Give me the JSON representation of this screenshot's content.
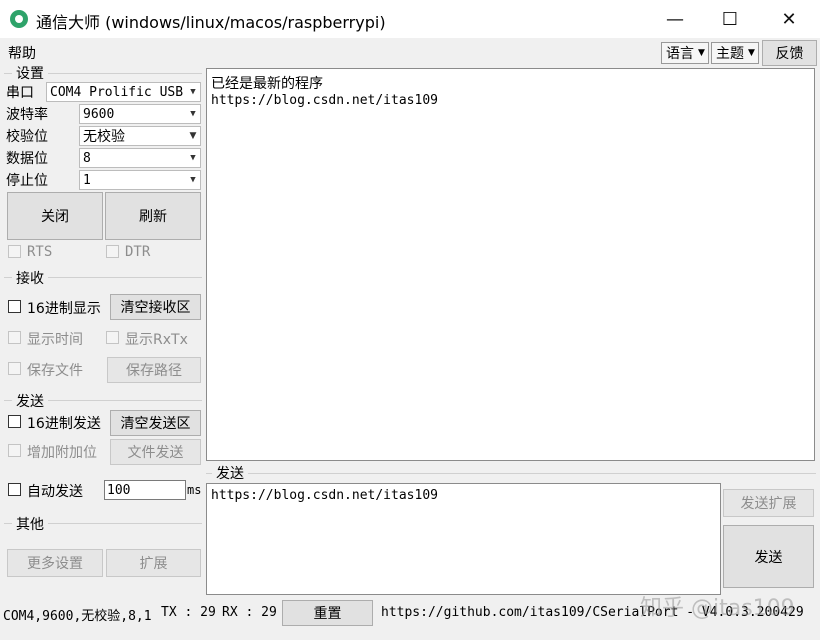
{
  "window": {
    "title": "通信大师 (windows/linux/macos/raspberrypi)",
    "minimize_glyph": "—",
    "maximize_glyph": "☐",
    "close_glyph": "✕"
  },
  "menu": {
    "help": "帮助"
  },
  "topbar": {
    "language_label": "语言",
    "theme_label": "主题",
    "feedback_label": "反馈",
    "dropdown_arrow": "▼"
  },
  "settings": {
    "group_title": "设置",
    "port_label": "串口",
    "port_value": "COM4 Prolific USB",
    "baud_label": "波特率",
    "baud_value": "9600",
    "parity_label": "校验位",
    "parity_value": "无校验",
    "databits_label": "数据位",
    "databits_value": "8",
    "stopbits_label": "停止位",
    "stopbits_value": "1",
    "close_button": "关闭",
    "refresh_button": "刷新",
    "rts_label": "RTS",
    "dtr_label": "DTR"
  },
  "receive": {
    "group_title": "接收",
    "hex_display_label": "16进制显示",
    "clear_button": "清空接收区",
    "show_time_label": "显示时间",
    "show_rxtx_label": "显示RxTx",
    "save_file_label": "保存文件",
    "save_path_button": "保存路径",
    "content_line1": "已经是最新的程序",
    "content_line2": "https://blog.csdn.net/itas109"
  },
  "send": {
    "group_title": "发送",
    "hex_send_label": "16进制发送",
    "clear_button": "清空发送区",
    "append_bit_label": "增加附加位",
    "file_send_button": "文件发送",
    "auto_send_label": "自动发送",
    "interval_value": "100",
    "interval_unit": "ms",
    "area_title": "发送",
    "content": "https://blog.csdn.net/itas109",
    "expand_button": "发送扩展",
    "send_button": "发送"
  },
  "other": {
    "group_title": "其他",
    "more_settings_button": "更多设置",
    "extend_button": "扩展"
  },
  "status": {
    "port_info": "COM4,9600,无校验,8,1",
    "tx": "TX : 29",
    "rx": "RX : 29",
    "reset_button": "重置",
    "link": "https://github.com/itas109/CSerialPort - V4.0.3.200429",
    "watermark": "知乎 @itas109"
  },
  "colors": {
    "title_icon": "#2ea36a",
    "background": "#f0f0f0"
  }
}
